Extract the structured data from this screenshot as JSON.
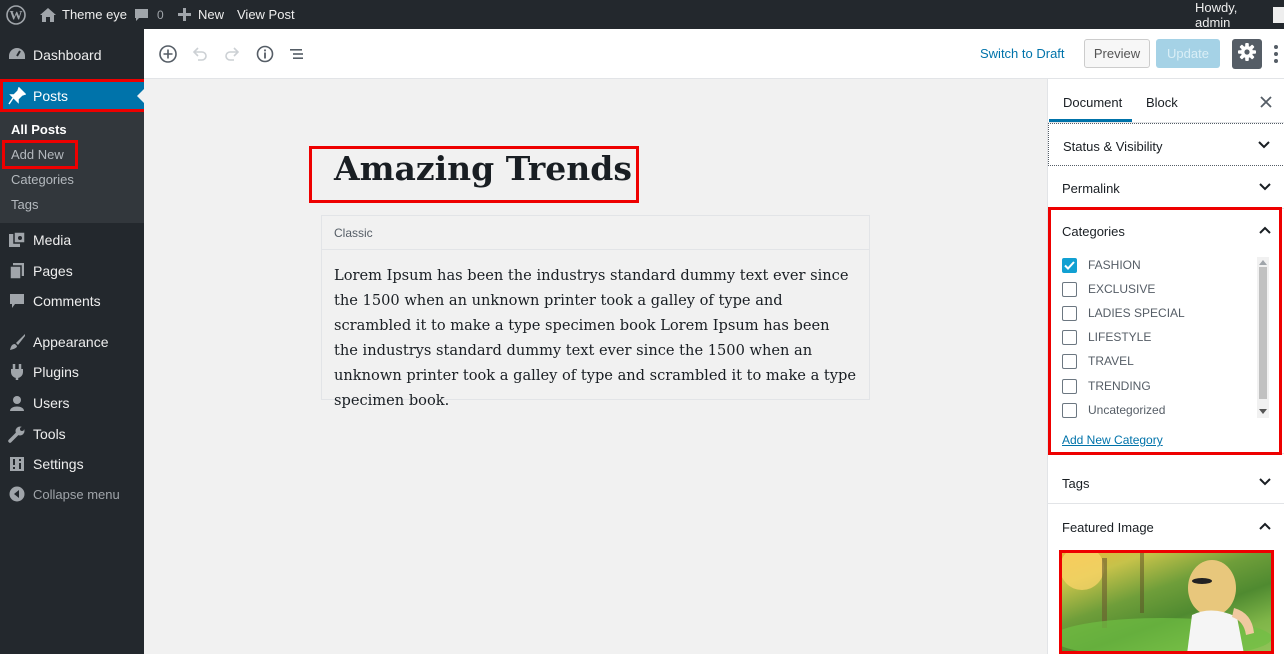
{
  "adminbar": {
    "site_name": "Theme eye",
    "comments_count": "0",
    "new_label": "New",
    "view_post_label": "View Post",
    "greeting": "Howdy, admin"
  },
  "sidebar": {
    "items": [
      {
        "label": "Dashboard",
        "icon": "dashboard-icon"
      },
      {
        "label": "Posts",
        "icon": "pin-icon"
      },
      {
        "label": "Media",
        "icon": "media-icon"
      },
      {
        "label": "Pages",
        "icon": "pages-icon"
      },
      {
        "label": "Comments",
        "icon": "comment-icon"
      },
      {
        "label": "Appearance",
        "icon": "brush-icon"
      },
      {
        "label": "Plugins",
        "icon": "plug-icon"
      },
      {
        "label": "Users",
        "icon": "user-icon"
      },
      {
        "label": "Tools",
        "icon": "wrench-icon"
      },
      {
        "label": "Settings",
        "icon": "settings-icon"
      },
      {
        "label": "Collapse menu",
        "icon": "collapse-icon"
      }
    ],
    "posts_submenu": [
      "All Posts",
      "Add New",
      "Categories",
      "Tags"
    ]
  },
  "toolbar": {
    "switch_to_draft": "Switch to Draft",
    "preview": "Preview",
    "update": "Update"
  },
  "editor": {
    "title": "Amazing Trends",
    "block_label": "Classic",
    "content": "Lorem Ipsum has been the industrys standard dummy text ever since the 1500 when an unknown printer took a galley of type and scrambled it to make a type specimen book Lorem Ipsum has been the industrys standard dummy text ever since the 1500 when an unknown printer took a galley of type and scrambled it to make a type specimen book."
  },
  "settings": {
    "tabs": [
      "Document",
      "Block"
    ],
    "active_tab": "Document",
    "panels": {
      "status": "Status & Visibility",
      "permalink": "Permalink",
      "categories": "Categories",
      "tags": "Tags",
      "featured_image": "Featured Image"
    },
    "categories": [
      {
        "name": "FASHION",
        "checked": true
      },
      {
        "name": "EXCLUSIVE",
        "checked": false
      },
      {
        "name": "LADIES SPECIAL",
        "checked": false
      },
      {
        "name": "LIFESTYLE",
        "checked": false
      },
      {
        "name": "TRAVEL",
        "checked": false
      },
      {
        "name": "TRENDING",
        "checked": false
      },
      {
        "name": "Uncategorized",
        "checked": false
      }
    ],
    "add_new_category": "Add New Category"
  },
  "colors": {
    "admin_dark": "#23282d",
    "accent_blue": "#0073aa",
    "highlight_red": "#e00000",
    "checkbox_blue": "#11a0d2"
  }
}
